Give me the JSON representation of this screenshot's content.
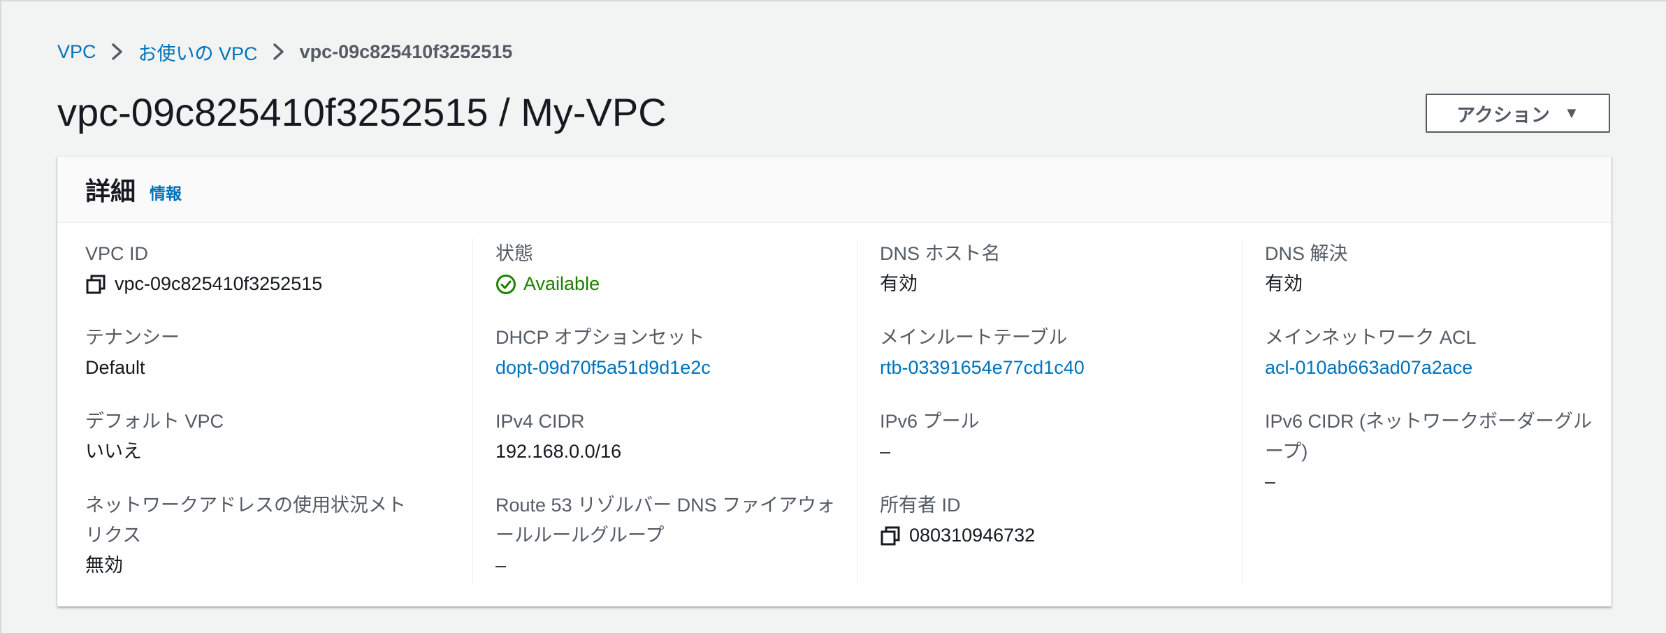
{
  "breadcrumb": {
    "items": [
      "VPC",
      "お使いの VPC",
      "vpc-09c825410f3252515"
    ]
  },
  "header": {
    "title": "vpc-09c825410f3252515 / My-VPC",
    "action_label": "アクション",
    "action_caret": "▼"
  },
  "details": {
    "title": "詳細",
    "info_label": "情報",
    "columns": [
      [
        {
          "label": "VPC ID",
          "value": "vpc-09c825410f3252515",
          "icon": "copy-icon"
        },
        {
          "label": "テナンシー",
          "value": "Default"
        },
        {
          "label": "デフォルト VPC",
          "value": "いいえ"
        },
        {
          "label": "ネットワークアドレスの使用状況メトリクス",
          "value": "無効"
        }
      ],
      [
        {
          "label": "状態",
          "value": "Available",
          "icon": "check-circle-icon"
        },
        {
          "label": "DHCP オプションセット",
          "value": "dopt-09d70f5a51d9d1e2c"
        },
        {
          "label": "IPv4 CIDR",
          "value": "192.168.0.0/16"
        },
        {
          "label": "Route 53 リゾルバー DNS ファイアウォールルールグループ",
          "value": "–"
        }
      ],
      [
        {
          "label": "DNS ホスト名",
          "value": "有効"
        },
        {
          "label": "メインルートテーブル",
          "value": "rtb-03391654e77cd1c40"
        },
        {
          "label": "IPv6 プール",
          "value": "–"
        },
        {
          "label": "所有者 ID",
          "value": "080310946732",
          "icon": "copy-icon"
        }
      ],
      [
        {
          "label": "DNS 解決",
          "value": "有効"
        },
        {
          "label": "メインネットワーク ACL",
          "value": "acl-010ab663ad07a2ace"
        },
        {
          "label": "IPv6 CIDR (ネットワークボーダーグループ)",
          "value": "–"
        }
      ]
    ]
  },
  "colors": {
    "link": "#0073bb",
    "success": "#1d8102",
    "background": "#f2f3f3",
    "text": "#16191f",
    "label": "#545b64"
  }
}
